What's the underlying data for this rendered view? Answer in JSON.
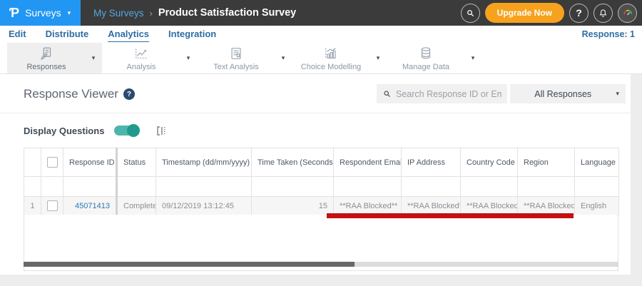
{
  "glyphs": {
    "caret_down": "▾",
    "breadcrumb_sep": "›",
    "help": "?"
  },
  "topbar": {
    "logo_glyph": "Ƥ",
    "menu_label": "Surveys",
    "breadcrumb_parent": "My Surveys",
    "breadcrumb_current": "Product Satisfaction Survey",
    "upgrade_label": "Upgrade Now"
  },
  "tabs": {
    "items": [
      {
        "label": "Edit",
        "active": false
      },
      {
        "label": "Distribute",
        "active": false
      },
      {
        "label": "Analytics",
        "active": true
      },
      {
        "label": "Integration",
        "active": false
      }
    ],
    "response_count": "Response: 1"
  },
  "toolbar": {
    "items": [
      {
        "label": "Responses",
        "icon": "responses-icon",
        "active": true
      },
      {
        "label": "Analysis",
        "icon": "analysis-icon",
        "active": false
      },
      {
        "label": "Text Analysis",
        "icon": "text-analysis-icon",
        "active": false
      },
      {
        "label": "Choice Modelling",
        "icon": "choice-modelling-icon",
        "active": false
      },
      {
        "label": "Manage Data",
        "icon": "manage-data-icon",
        "active": false
      }
    ]
  },
  "viewer": {
    "title": "Response Viewer",
    "search_placeholder": "Search Response ID or Email",
    "responses_filter": "All Responses",
    "display_questions_label": "Display Questions",
    "display_questions_on": true
  },
  "table": {
    "headers": [
      {
        "label": ""
      },
      {
        "label": "",
        "type": "checkbox"
      },
      {
        "label": "Response ID",
        "sort_icon": "▼"
      },
      {
        "label": "Status"
      },
      {
        "label": "Timestamp (dd/mm/yyyy)",
        "sort_icon": "⇅"
      },
      {
        "label": "Time Taken (Seconds)",
        "sort_icon": "⇅"
      },
      {
        "label": "Respondent Email"
      },
      {
        "label": "IP Address"
      },
      {
        "label": "Country Code"
      },
      {
        "label": "Region"
      },
      {
        "label": "Language"
      }
    ],
    "rows": [
      {
        "num": "1",
        "response_id": "45071413",
        "status": "Completed",
        "timestamp": "09/12/2019 13:12:45",
        "time_taken": "15",
        "respondent_email": "**RAA Blocked**",
        "ip_address": "**RAA Blocked**",
        "country_code": "**RAA Blocked**",
        "region": "**RAA Blocked**",
        "language": "English"
      }
    ]
  },
  "colors": {
    "brand_blue": "#2196f3",
    "topbar_dark": "#3b3b3b",
    "accent_orange": "#f6a21e",
    "link_blue": "#2e6da4",
    "toggle_teal": "#26a69a",
    "annotation_red": "#c41111"
  }
}
